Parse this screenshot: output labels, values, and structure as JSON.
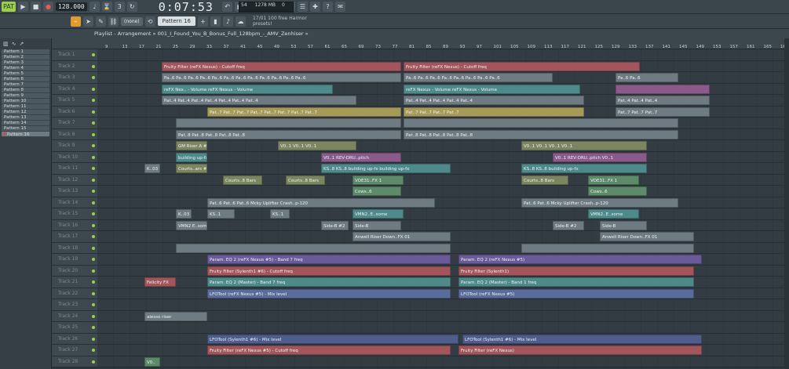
{
  "transport": {
    "tempo": "128.000",
    "time": "0:07:53",
    "pattern_mode": "PAT",
    "cpu": "54",
    "memory": "1278 MB",
    "voices": "0"
  },
  "toolbar": {
    "snap": "(none)",
    "pattern": "Pattern 16",
    "hint_line1": "17/01  100 free Harmor",
    "hint_line2": "presets!"
  },
  "playlist": {
    "title": "Playlist - Arrangement » 001_I_Found_You_B_Bonus_Full_128bpm_-_AMV_Zenhiser »"
  },
  "patterns": [
    "Pattern 1",
    "Pattern 2",
    "Pattern 3",
    "Pattern 4",
    "Pattern 5",
    "Pattern 6",
    "Pattern 7",
    "Pattern 8",
    "Pattern 9",
    "Pattern 10",
    "Pattern 11",
    "Pattern 12",
    "Pattern 13",
    "Pattern 14",
    "Pattern 15",
    "Pattern 16"
  ],
  "ruler": [
    "9",
    "13",
    "17",
    "21",
    "25",
    "29",
    "33",
    "37",
    "41",
    "45",
    "49",
    "53",
    "57",
    "61",
    "65",
    "69",
    "73",
    "77",
    "81",
    "85",
    "89",
    "93",
    "97",
    "101",
    "105",
    "109",
    "113",
    "117",
    "121",
    "125",
    "129",
    "133",
    "137",
    "141",
    "145",
    "149",
    "153",
    "157",
    "161",
    "165",
    "169"
  ],
  "tracks": [
    {
      "name": "Track 1",
      "clips": []
    },
    {
      "name": "Track 2",
      "clips": [
        {
          "label": "Fruity Filter (reFX Nexus) - Cutoff freq",
          "color": "red",
          "from": 82,
          "to": 387
        },
        {
          "label": "Fruity Filter (reFX Nexus) - Cutoff freq",
          "color": "red",
          "from": 390,
          "to": 691
        }
      ]
    },
    {
      "name": "Track 3",
      "clips": [
        {
          "label": "Pa..6  Pa..6  Pa..6  Pa..6  Pa..6  Pa..6  Pa..6  Pa..6  Pa..6  Pa..6  Pa..6  Pa..6",
          "color": "grey",
          "from": 82,
          "to": 387
        },
        {
          "label": "Pa..6  Pa..6  Pa..6  Pa..6  Pa..6  Pa..6  Pa..6  Pa..6",
          "color": "grey",
          "from": 390,
          "to": 580
        },
        {
          "label": "Pa..6  Pa..6",
          "color": "grey",
          "from": 660,
          "to": 740
        }
      ]
    },
    {
      "name": "Track 4",
      "clips": [
        {
          "label": "reFX Nex.. - Volume  reFX Nexus - Volume",
          "color": "teal",
          "from": 82,
          "to": 300
        },
        {
          "label": "reFX Nexus - Volume  reFX Nexus - Volume",
          "color": "teal",
          "from": 390,
          "to": 615
        },
        {
          "label": "",
          "color": "mauve",
          "from": 660,
          "to": 780
        }
      ]
    },
    {
      "name": "Track 5",
      "clips": [
        {
          "label": "Pat..4  Pat..4  Pat..4  Pat..4  Pat..4  Pat..4  Pat..4",
          "color": "grey",
          "from": 82,
          "to": 330
        },
        {
          "label": "Pat..4  Pat..4  Pat..4  Pat..4  Pat..4",
          "color": "grey",
          "from": 390,
          "to": 620
        },
        {
          "label": "Pat..4  Pat..4  Pat..4",
          "color": "grey",
          "from": 660,
          "to": 780
        }
      ]
    },
    {
      "name": "Track 6",
      "clips": [
        {
          "label": "Pat..7  Pat..7  Pat..7  Pat..7  Pat..7  Pat..7  Pat..7  Pat..7",
          "color": "khaki",
          "from": 140,
          "to": 387
        },
        {
          "label": "Pat..7  Pat..7  Pat..7  Pat..7",
          "color": "khaki",
          "from": 390,
          "to": 620
        },
        {
          "label": "Pat..7  Pat..7  Pat..7",
          "color": "grey",
          "from": 660,
          "to": 780
        }
      ]
    },
    {
      "name": "Track 7",
      "clips": [
        {
          "label": "",
          "color": "grey",
          "from": 100,
          "to": 387
        },
        {
          "label": "",
          "color": "grey",
          "from": 390,
          "to": 740
        }
      ]
    },
    {
      "name": "Track 8",
      "clips": [
        {
          "label": "Pat..8  Pat..8  Pat..8  Pat..8  Pat..8",
          "color": "grey",
          "from": 100,
          "to": 387
        },
        {
          "label": "Pat..8  Pat..8  Pat..8  Pat..8  Pat..8",
          "color": "grey",
          "from": 390,
          "to": 740
        }
      ]
    },
    {
      "name": "Track 9",
      "clips": [
        {
          "label": "GM Riser A #2",
          "color": "olive",
          "from": 100,
          "to": 140
        },
        {
          "label": "V0..1  V0..1  V0..1",
          "color": "olive",
          "from": 230,
          "to": 330
        },
        {
          "label": "V0..1  V0..1  V0..1  V0..1",
          "color": "olive",
          "from": 540,
          "to": 700
        }
      ]
    },
    {
      "name": "Track 10",
      "clips": [
        {
          "label": "building up-fx",
          "color": "teal",
          "from": 100,
          "to": 140
        },
        {
          "label": "V0..1  REV-DRU..pitch",
          "color": "mauve",
          "from": 285,
          "to": 387
        },
        {
          "label": "V0..1  REV-DRU..pitch  V0..1",
          "color": "mauve",
          "from": 580,
          "to": 700
        }
      ]
    },
    {
      "name": "Track 11",
      "clips": [
        {
          "label": "K..03",
          "color": "grey",
          "from": 60,
          "to": 80
        },
        {
          "label": "Courts..ars #2",
          "color": "olive",
          "from": 100,
          "to": 140
        },
        {
          "label": "KS..8  KS..8  building up-fx  building up-fx",
          "color": "teal",
          "from": 285,
          "to": 450
        },
        {
          "label": "KS..8  KS..8  building up-fx",
          "color": "teal",
          "from": 540,
          "to": 700
        }
      ]
    },
    {
      "name": "Track 12",
      "clips": [
        {
          "label": "Courts..8 Bars",
          "color": "olive",
          "from": 160,
          "to": 210
        },
        {
          "label": "Courts..8 Bars",
          "color": "olive",
          "from": 240,
          "to": 290
        },
        {
          "label": "VOE31..FX 1",
          "color": "green",
          "from": 325,
          "to": 390
        },
        {
          "label": "Courts..8 Bars",
          "color": "olive",
          "from": 540,
          "to": 600
        },
        {
          "label": "VOE31..FX 1",
          "color": "green",
          "from": 625,
          "to": 690
        }
      ]
    },
    {
      "name": "Track 13",
      "clips": [
        {
          "label": "Cows..6",
          "color": "green",
          "from": 325,
          "to": 387
        },
        {
          "label": "Cows..6",
          "color": "green",
          "from": 625,
          "to": 700
        }
      ]
    },
    {
      "name": "Track 14",
      "clips": [
        {
          "label": "Pat..6  Pat..6  Pat..6  Mcky Uplifter  Crash..p-120",
          "color": "grey",
          "from": 140,
          "to": 430
        },
        {
          "label": "Pat..6  Pat..6  Mcky Uplifter  Crash..p-120",
          "color": "grey",
          "from": 540,
          "to": 740
        }
      ]
    },
    {
      "name": "Track 15",
      "clips": [
        {
          "label": "K..03",
          "color": "grey",
          "from": 100,
          "to": 120
        },
        {
          "label": "KS..1",
          "color": "grey",
          "from": 140,
          "to": 175
        },
        {
          "label": "KS..1",
          "color": "grey",
          "from": 220,
          "to": 245
        },
        {
          "label": "VMN2..E..some",
          "color": "teal",
          "from": 325,
          "to": 390
        },
        {
          "label": "VMN2..E..some",
          "color": "teal",
          "from": 625,
          "to": 690
        }
      ]
    },
    {
      "name": "Track 16",
      "clips": [
        {
          "label": "VMN2 E..some",
          "color": "grey",
          "from": 100,
          "to": 140
        },
        {
          "label": "Side-B #2",
          "color": "grey",
          "from": 285,
          "to": 320
        },
        {
          "label": "Side-B",
          "color": "grey",
          "from": 325,
          "to": 387
        },
        {
          "label": "Side-B #2",
          "color": "grey",
          "from": 580,
          "to": 620
        },
        {
          "label": "Side-B",
          "color": "grey",
          "from": 640,
          "to": 700
        }
      ]
    },
    {
      "name": "Track 17",
      "clips": [
        {
          "label": "Anwell Riser  Down..FX 01",
          "color": "grey",
          "from": 325,
          "to": 450
        },
        {
          "label": "Anwell Riser  Down..FX 01",
          "color": "grey",
          "from": 640,
          "to": 760
        }
      ]
    },
    {
      "name": "Track 18",
      "clips": [
        {
          "label": "",
          "color": "grey",
          "from": 100,
          "to": 450
        },
        {
          "label": "",
          "color": "grey",
          "from": 540,
          "to": 760
        }
      ]
    },
    {
      "name": "Track 19",
      "clips": [
        {
          "label": "Param. EQ 2 (reFX Nexus #5) - Band 7 freq",
          "color": "purple",
          "from": 140,
          "to": 450
        },
        {
          "label": "Param. EQ 2 (reFX Nexus #5)",
          "color": "purple",
          "from": 460,
          "to": 770
        }
      ]
    },
    {
      "name": "Track 20",
      "clips": [
        {
          "label": "Fruity Filter (Sylenth1 #6) - Cutoff freq",
          "color": "red",
          "from": 140,
          "to": 450
        },
        {
          "label": "Fruity Filter (Sylenth1)",
          "color": "red",
          "from": 460,
          "to": 760
        }
      ]
    },
    {
      "name": "Track 21",
      "clips": [
        {
          "label": "Felicity FX",
          "color": "red",
          "from": 60,
          "to": 100
        },
        {
          "label": "Param. EQ 2 (Master) - Band 7 freq",
          "color": "teal",
          "from": 140,
          "to": 450
        },
        {
          "label": "Param. EQ 2 (Master) - Band 1 freq",
          "color": "teal",
          "from": 460,
          "to": 760
        }
      ]
    },
    {
      "name": "Track 22",
      "clips": [
        {
          "label": "LFOTool (reFX Nexus #5) - Mix level",
          "color": "blue",
          "from": 140,
          "to": 450
        },
        {
          "label": "LFOTool (reFX Nexus #5)",
          "color": "blue",
          "from": 460,
          "to": 760
        }
      ]
    },
    {
      "name": "Track 23",
      "clips": []
    },
    {
      "name": "Track 24",
      "clips": [
        {
          "label": "alesso riser",
          "color": "grey",
          "from": 60,
          "to": 140
        }
      ]
    },
    {
      "name": "Track 25",
      "clips": []
    },
    {
      "name": "Track 26",
      "clips": [
        {
          "label": "LFOTool (Sylenth1 #6) - Mix level",
          "color": "slate",
          "from": 140,
          "to": 460
        },
        {
          "label": "LFOTool (Sylenth1 #6) - Mix level",
          "color": "slate",
          "from": 465,
          "to": 770
        }
      ]
    },
    {
      "name": "Track 27",
      "clips": [
        {
          "label": "Fruity Filter (reFX Nexus #5) - Cutoff freq",
          "color": "red",
          "from": 140,
          "to": 450
        },
        {
          "label": "Fruity Filter (reFX Nexus)",
          "color": "red",
          "from": 460,
          "to": 770
        }
      ]
    },
    {
      "name": "Track 28",
      "clips": [
        {
          "label": "V0..",
          "color": "green",
          "from": 60,
          "to": 80
        }
      ]
    }
  ]
}
